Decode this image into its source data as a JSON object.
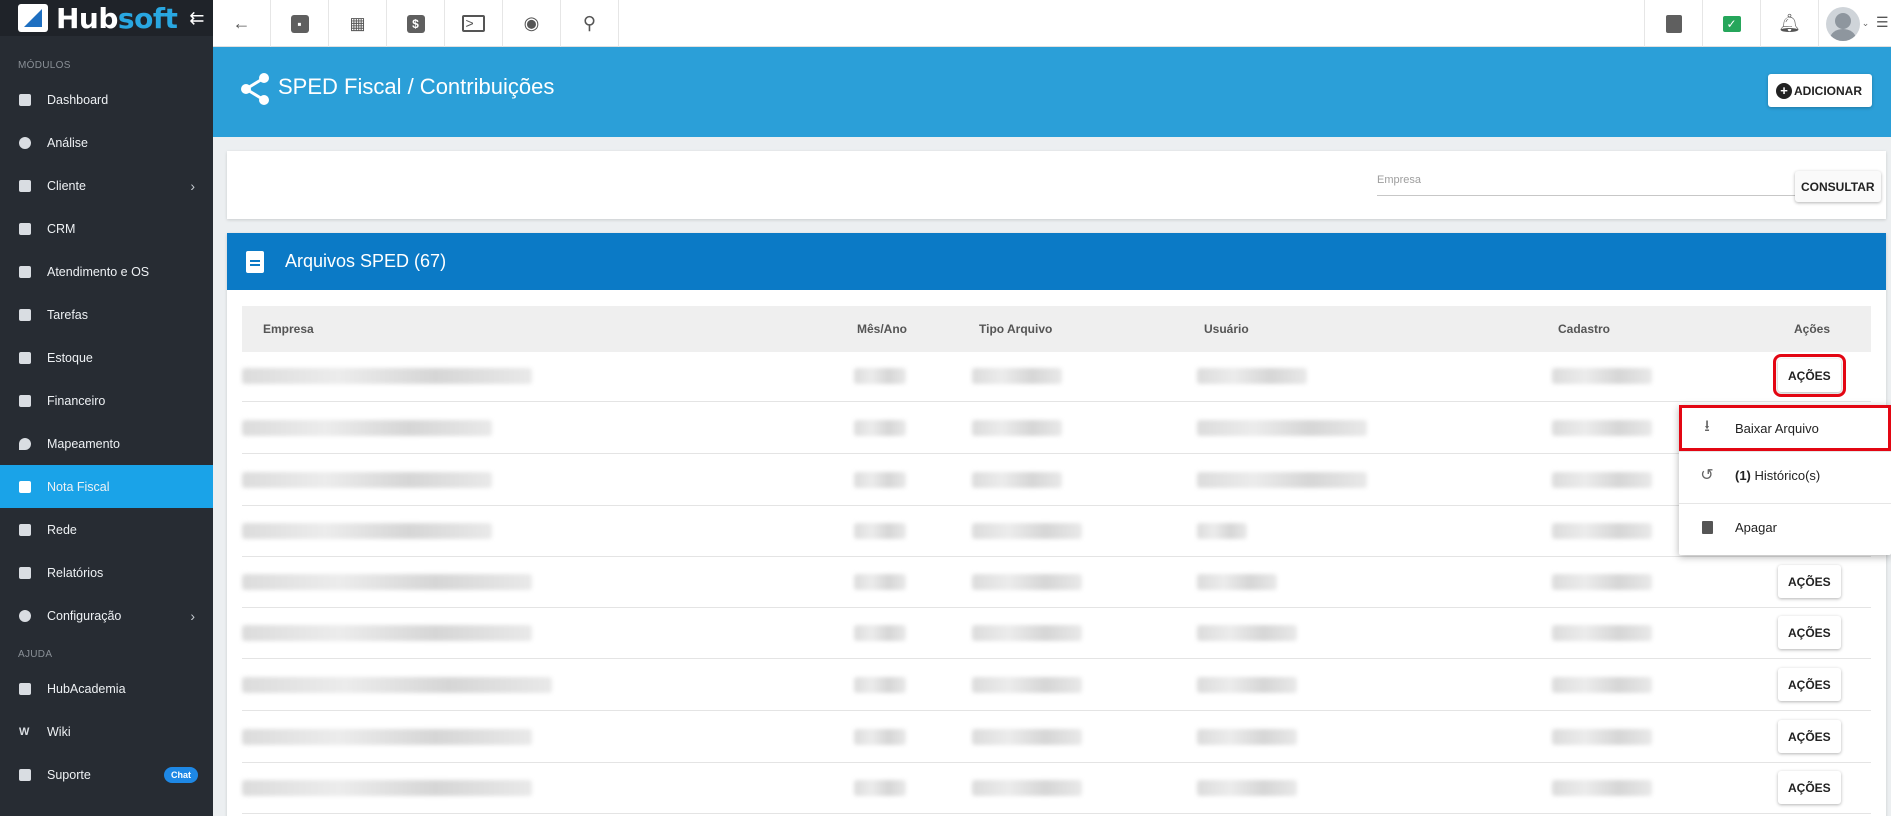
{
  "app": {
    "logo_hub": "Hub",
    "logo_soft": "soft"
  },
  "sidebar": {
    "section_modules": "MÓDULOS",
    "section_help": "AJUDA",
    "items": [
      {
        "label": "Dashboard",
        "icon": "dashboard-icon"
      },
      {
        "label": "Análise",
        "icon": "chart-icon"
      },
      {
        "label": "Cliente",
        "icon": "client-icon"
      },
      {
        "label": "CRM",
        "icon": "crm-icon"
      },
      {
        "label": "Atendimento e OS",
        "icon": "support-icon"
      },
      {
        "label": "Tarefas",
        "icon": "tasks-icon"
      },
      {
        "label": "Estoque",
        "icon": "box-icon"
      },
      {
        "label": "Financeiro",
        "icon": "money-icon"
      },
      {
        "label": "Mapeamento",
        "icon": "map-pin-icon"
      },
      {
        "label": "Nota Fiscal",
        "icon": "invoice-icon"
      },
      {
        "label": "Rede",
        "icon": "network-icon"
      },
      {
        "label": "Relatórios",
        "icon": "report-icon"
      },
      {
        "label": "Configuração",
        "icon": "gear-icon"
      }
    ],
    "help_items": [
      {
        "label": "HubAcademia",
        "icon": "video-icon"
      },
      {
        "label": "Wiki",
        "icon": "wiki-icon"
      },
      {
        "label": "Suporte",
        "icon": "chat-icon",
        "badge": "Chat"
      }
    ]
  },
  "header": {
    "title": "SPED Fiscal / Contribuições",
    "add_label": "ADICIONAR"
  },
  "filter": {
    "empresa_placeholder": "Empresa",
    "consultar_label": "CONSULTAR"
  },
  "files": {
    "title": "Arquivos SPED (67)",
    "columns": [
      "Empresa",
      "Mês/Ano",
      "Tipo Arquivo",
      "Usuário",
      "Cadastro",
      "Ações"
    ],
    "row_action_label": "AÇÕES"
  },
  "dropdown": {
    "download_label": "Baixar Arquivo",
    "history_count": "(1)",
    "history_label": " Histórico(s)",
    "delete_label": "Apagar"
  },
  "colors": {
    "sidebar_bg": "#272c33",
    "active_item": "#1aa3e8",
    "header_band": "#2b9fd8",
    "card_header": "#0b7ac6",
    "highlight": "#e30613"
  }
}
